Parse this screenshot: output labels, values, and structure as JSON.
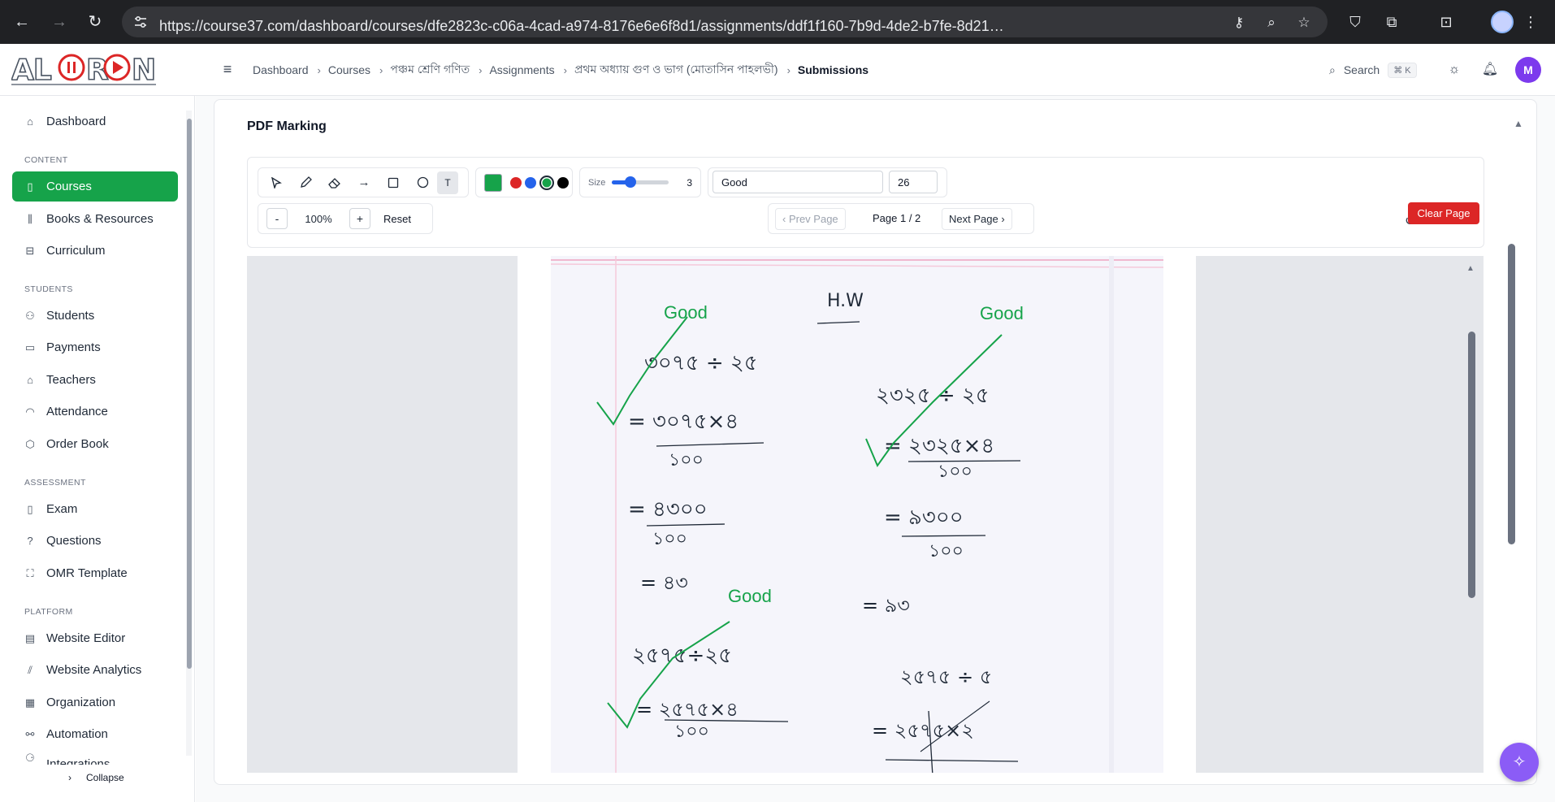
{
  "browser": {
    "url": "https://course37.com/dashboard/courses/dfe2823c-c06a-4cad-a974-8176e6e6f8d1/assignments/ddf1f160-7b9d-4de2-b7fe-8d21e780ae4b/submissions?name=প্রথ…"
  },
  "header": {
    "logo_text": "ALORON",
    "breadcrumbs": [
      "Dashboard",
      "Courses",
      "পঞ্চম শ্রেণি গণিত",
      "Assignments",
      "প্রথম অধ্যায় গুণ ও ভাগ (মোতাসিন পাহলভী)",
      "Submissions"
    ],
    "search_label": "Search",
    "search_shortcut": "⌘ K",
    "avatar_initial": "M"
  },
  "sidebar": {
    "items_top": [
      {
        "label": "Dashboard",
        "icon": "home-icon"
      }
    ],
    "sections": [
      {
        "title": "CONTENT",
        "items": [
          "Courses",
          "Books & Resources",
          "Curriculum"
        ]
      },
      {
        "title": "STUDENTS",
        "items": [
          "Students",
          "Payments",
          "Teachers",
          "Attendance",
          "Order Book"
        ]
      },
      {
        "title": "ASSESSMENT",
        "items": [
          "Exam",
          "Questions",
          "OMR Template"
        ]
      },
      {
        "title": "PLATFORM",
        "items": [
          "Website Editor",
          "Website Analytics",
          "Organization",
          "Automation",
          "Integrations"
        ]
      }
    ],
    "active_item": "Courses",
    "collapse_label": "Collapse"
  },
  "marking": {
    "title": "PDF Marking",
    "active_color": "#16a34a",
    "palette": [
      "#dc2626",
      "#2563eb",
      "#16a34a",
      "#000000"
    ],
    "size_label": "Size",
    "size_value": "3",
    "size_fraction": 0.3,
    "text_value": "Good",
    "font_size_value": "26",
    "zoom_out": "-",
    "zoom_level": "100%",
    "zoom_in": "+",
    "reset_label": "Reset",
    "prev_label": "Prev Page",
    "page_indicator": "Page 1 / 2",
    "next_label": "Next Page",
    "clear_label": "Clear Page"
  },
  "annotations": {
    "note_1": "Good",
    "note_2": "Good",
    "note_3": "Good"
  },
  "handwriting": {
    "heading": "H.W",
    "l1": "৩০৭৫ ÷ ২৫",
    "l2": "= ৩০৭৫×৪",
    "l3": "১০০",
    "l4": "= ৪৩০০",
    "l5": "১০০",
    "l6": "= ৪৩",
    "r1": "২৩২৫ ÷ ২৫",
    "r2": "= ২৩২৫×৪",
    "r3": "১০০",
    "r4": "= ৯৩০০",
    "r5": "১০০",
    "r6": "= ৯৩",
    "b1": "২৫৭৫÷২৫",
    "b2": "= ২৫৭৫×৪",
    "b3": "১০০",
    "b4": "২৫৭৫ ÷ ৫",
    "b5": "= ২৫৭৫×২"
  }
}
